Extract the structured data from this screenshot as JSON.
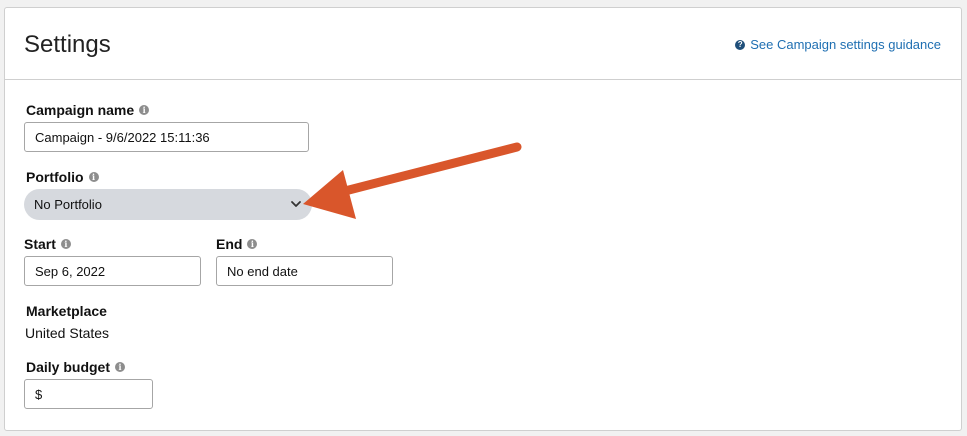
{
  "header": {
    "title": "Settings",
    "guidance_link": "See Campaign settings guidance"
  },
  "fields": {
    "campaign_name": {
      "label": "Campaign name",
      "value": "Campaign - 9/6/2022 15:11:36"
    },
    "portfolio": {
      "label": "Portfolio",
      "value": "No Portfolio"
    },
    "start": {
      "label": "Start",
      "value": "Sep 6, 2022"
    },
    "end": {
      "label": "End",
      "value": "No end date"
    },
    "marketplace": {
      "label": "Marketplace",
      "value": "United States"
    },
    "daily_budget": {
      "label": "Daily budget",
      "value": "$"
    }
  },
  "icons": {
    "info_glyph": "i",
    "help_glyph": "?"
  },
  "colors": {
    "link": "#1f6fb2",
    "annotation_arrow": "#d9562b",
    "select_bg": "#d6d9de"
  }
}
